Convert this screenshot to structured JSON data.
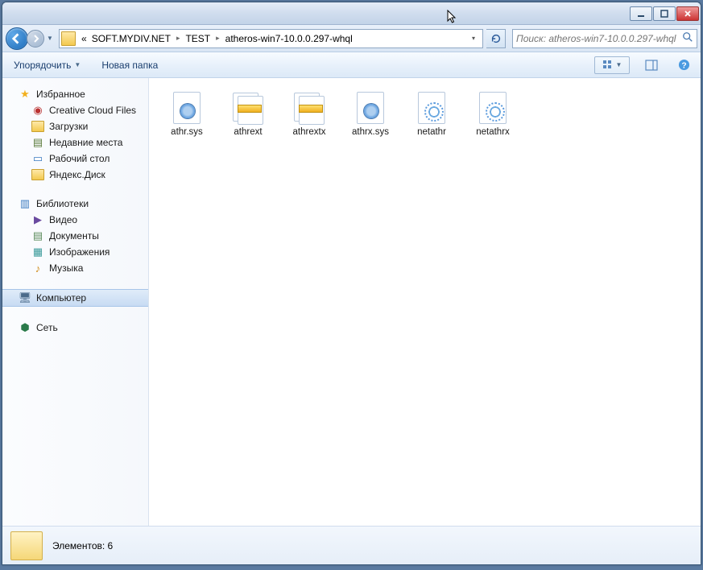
{
  "breadcrumb": {
    "prefix": "«",
    "segments": [
      "SOFT.MYDIV.NET",
      "TEST",
      "atheros-win7-10.0.0.297-whql"
    ]
  },
  "search": {
    "placeholder": "Поиск: atheros-win7-10.0.0.297-whql"
  },
  "toolbar": {
    "organize": "Упорядочить",
    "newfolder": "Новая папка"
  },
  "sidebar": {
    "favorites": {
      "label": "Избранное",
      "items": [
        {
          "label": "Creative Cloud Files",
          "icon": "cloud"
        },
        {
          "label": "Загрузки",
          "icon": "dl"
        },
        {
          "label": "Недавние места",
          "icon": "recent"
        },
        {
          "label": "Рабочий стол",
          "icon": "desktop"
        },
        {
          "label": "Яндекс.Диск",
          "icon": "folder"
        }
      ]
    },
    "libraries": {
      "label": "Библиотеки",
      "items": [
        {
          "label": "Видео",
          "icon": "video"
        },
        {
          "label": "Документы",
          "icon": "doc"
        },
        {
          "label": "Изображения",
          "icon": "img"
        },
        {
          "label": "Музыка",
          "icon": "music"
        }
      ]
    },
    "computer": {
      "label": "Компьютер"
    },
    "network": {
      "label": "Сеть"
    }
  },
  "files": [
    {
      "name": "athr.sys",
      "type": "sys"
    },
    {
      "name": "athrext",
      "type": "cab"
    },
    {
      "name": "athrextx",
      "type": "cab"
    },
    {
      "name": "athrx.sys",
      "type": "sys"
    },
    {
      "name": "netathr",
      "type": "inf"
    },
    {
      "name": "netathrx",
      "type": "inf"
    }
  ],
  "status": {
    "count_label": "Элементов: 6"
  }
}
